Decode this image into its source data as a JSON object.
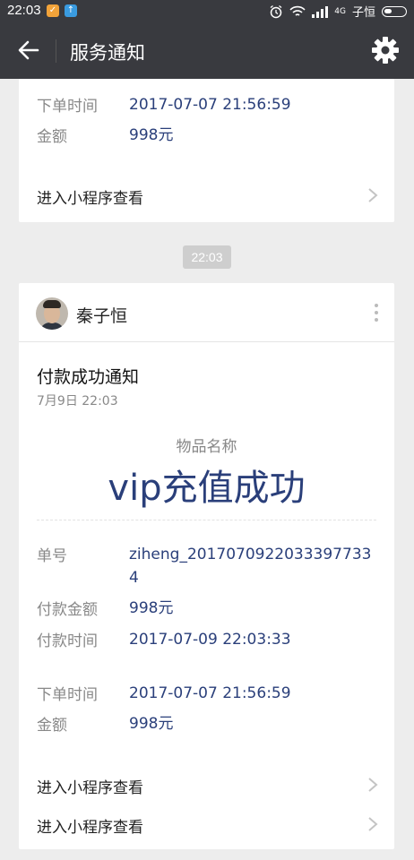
{
  "status_bar": {
    "time": "22:03",
    "network": "4G",
    "carrier": "子恒"
  },
  "nav": {
    "title": "服务通知"
  },
  "card_prev": {
    "rows": [
      {
        "label": "下单时间",
        "value": "2017-07-07 21:56:59"
      },
      {
        "label": "金额",
        "value": "998元"
      }
    ],
    "link": "进入小程序查看"
  },
  "timestamp": "22:03",
  "card_main": {
    "sender": "秦子恒",
    "title": "付款成功通知",
    "date": "7月9日  22:03",
    "item_label": "物品名称",
    "item_value": "vip充值成功",
    "rows": [
      {
        "label": "单号",
        "value": "ziheng_20170709220333977334"
      },
      {
        "label": "付款金额",
        "value": "998元"
      },
      {
        "label": "付款时间",
        "value": "2017-07-09 22:03:33"
      },
      {
        "label": "下单时间",
        "value": "2017-07-07 21:56:59"
      },
      {
        "label": "金额",
        "value": "998元"
      }
    ],
    "links": [
      "进入小程序查看",
      "进入小程序查看"
    ]
  },
  "colors": {
    "topbar": "#393a3f",
    "accent_value": "#2a3f7a",
    "background": "#ededed"
  },
  "icons": [
    "back-arrow-icon",
    "gear-icon",
    "more-vertical-icon",
    "chevron-right-icon",
    "alarm-icon",
    "wifi-icon",
    "signal-icon",
    "battery-icon"
  ]
}
